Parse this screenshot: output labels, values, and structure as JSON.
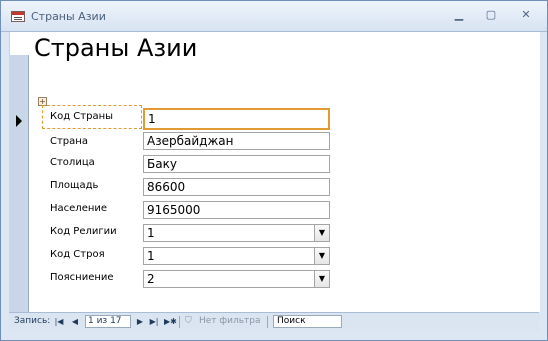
{
  "window": {
    "title": "Страны Азии"
  },
  "form": {
    "header": "Страны Азии",
    "fields": [
      {
        "label": "Код Страны",
        "value": "1",
        "type": "text"
      },
      {
        "label": "Страна",
        "value": "Азербайджан",
        "type": "text"
      },
      {
        "label": "Столица",
        "value": "Баку",
        "type": "text"
      },
      {
        "label": "Площадь",
        "value": "86600",
        "type": "text"
      },
      {
        "label": "Население",
        "value": "9165000",
        "type": "text"
      },
      {
        "label": "Код Религии",
        "value": "1",
        "type": "combo"
      },
      {
        "label": "Код Строя",
        "value": "1",
        "type": "combo"
      },
      {
        "label": "Поясниение",
        "value": "2",
        "type": "combo"
      }
    ]
  },
  "statusbar": {
    "record_label": "Запись:",
    "record_position": "1 из 17",
    "filter_label": "Нет фильтра",
    "search_label": "Поиск"
  },
  "colors": {
    "focus": "#e29a33",
    "title_text": "#4a5f7a",
    "frame": "#dde7f3"
  }
}
